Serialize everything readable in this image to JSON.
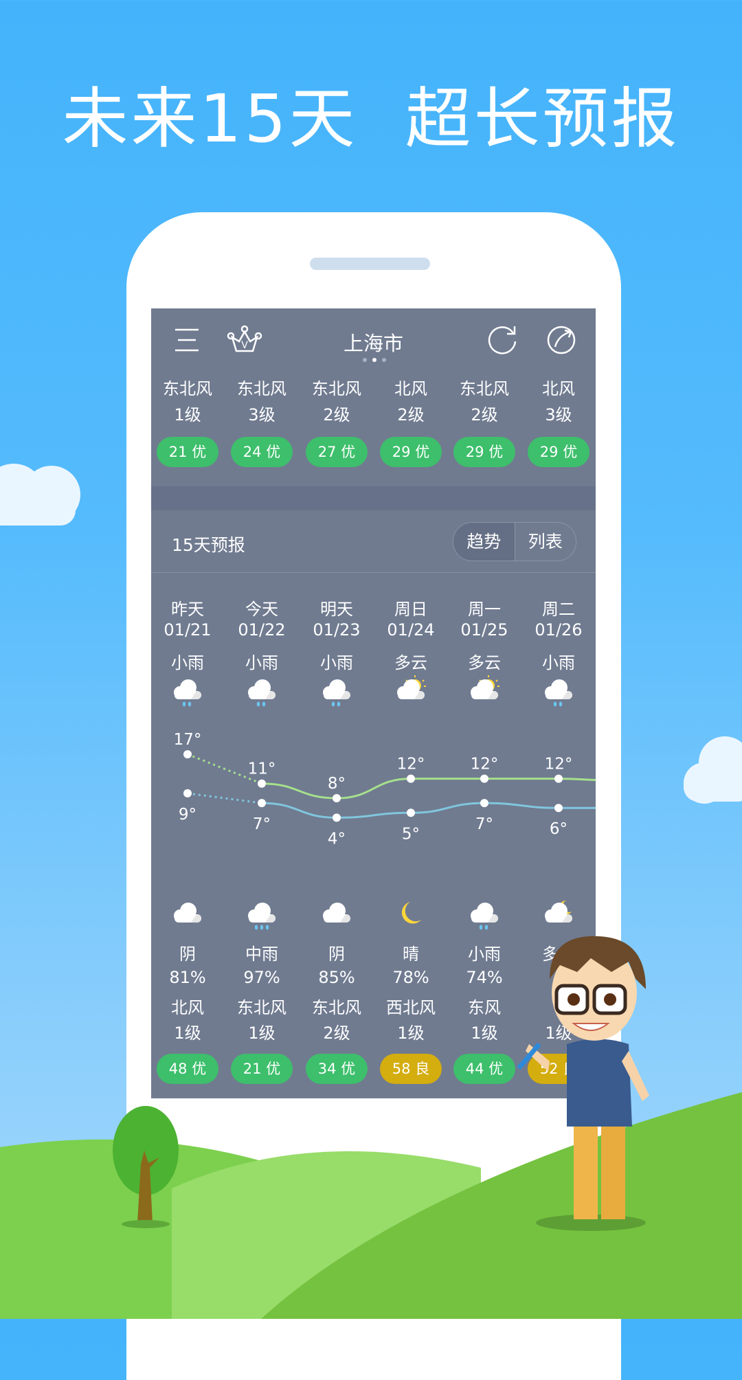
{
  "headline": "未来15天  超长预报",
  "topbar": {
    "city": "上海市",
    "menu_icon": "menu-icon",
    "vip_icon": "crown-vip-icon",
    "refresh_icon": "refresh-icon",
    "share_icon": "share-icon",
    "page_dots": 3,
    "active_dot": 2
  },
  "current_hours": [
    {
      "wind": "东北风",
      "level": "1级",
      "aqi": "21 优",
      "aqi_color": "#3dbf6b"
    },
    {
      "wind": "东北风",
      "level": "3级",
      "aqi": "24 优",
      "aqi_color": "#3dbf6b"
    },
    {
      "wind": "东北风",
      "level": "2级",
      "aqi": "27 优",
      "aqi_color": "#3dbf6b"
    },
    {
      "wind": "北风",
      "level": "2级",
      "aqi": "29 优",
      "aqi_color": "#3dbf6b"
    },
    {
      "wind": "东北风",
      "level": "2级",
      "aqi": "29 优",
      "aqi_color": "#3dbf6b"
    },
    {
      "wind": "北风",
      "level": "3级",
      "aqi": "29 优",
      "aqi_color": "#3dbf6b"
    }
  ],
  "forecast": {
    "title": "15天预报",
    "toggle": {
      "trend": "趋势",
      "list": "列表",
      "selected": "trend"
    },
    "days": [
      {
        "day": "昨天",
        "date": "01/21",
        "day_weather": "小雨",
        "day_icon": "light-rain",
        "high": 17,
        "low": 9,
        "night_icon": "overcast",
        "night_weather": "阴",
        "humidity": "81%",
        "wind": "北风",
        "level": "1级",
        "aqi": "48 优",
        "aqi_color": "#3dbf6b"
      },
      {
        "day": "今天",
        "date": "01/22",
        "day_weather": "小雨",
        "day_icon": "light-rain",
        "high": 11,
        "low": 7,
        "night_icon": "moderate-rain",
        "night_weather": "中雨",
        "humidity": "97%",
        "wind": "东北风",
        "level": "1级",
        "aqi": "21 优",
        "aqi_color": "#3dbf6b"
      },
      {
        "day": "明天",
        "date": "01/23",
        "day_weather": "小雨",
        "day_icon": "light-rain",
        "high": 8,
        "low": 4,
        "night_icon": "overcast",
        "night_weather": "阴",
        "humidity": "85%",
        "wind": "东北风",
        "level": "2级",
        "aqi": "34 优",
        "aqi_color": "#3dbf6b"
      },
      {
        "day": "周日",
        "date": "01/24",
        "day_weather": "多云",
        "day_icon": "partly-cloudy-day",
        "high": 12,
        "low": 5,
        "night_icon": "clear-night",
        "night_weather": "晴",
        "humidity": "78%",
        "wind": "西北风",
        "level": "1级",
        "aqi": "58 良",
        "aqi_color": "#d4ad0f"
      },
      {
        "day": "周一",
        "date": "01/25",
        "day_weather": "多云",
        "day_icon": "partly-cloudy-day",
        "high": 12,
        "low": 7,
        "night_icon": "light-rain",
        "night_weather": "小雨",
        "humidity": "74%",
        "wind": "东风",
        "level": "1级",
        "aqi": "44 优",
        "aqi_color": "#3dbf6b"
      },
      {
        "day": "周二",
        "date": "01/26",
        "day_weather": "小雨",
        "day_icon": "light-rain",
        "high": 12,
        "low": 6,
        "night_icon": "partly-cloudy-night",
        "night_weather": "多云",
        "humidity": "",
        "wind": "",
        "level": "1级",
        "aqi": "52 良",
        "aqi_color": "#d4ad0f"
      }
    ],
    "high_line_color": "#a6e08c",
    "low_line_color": "#80c6de"
  }
}
